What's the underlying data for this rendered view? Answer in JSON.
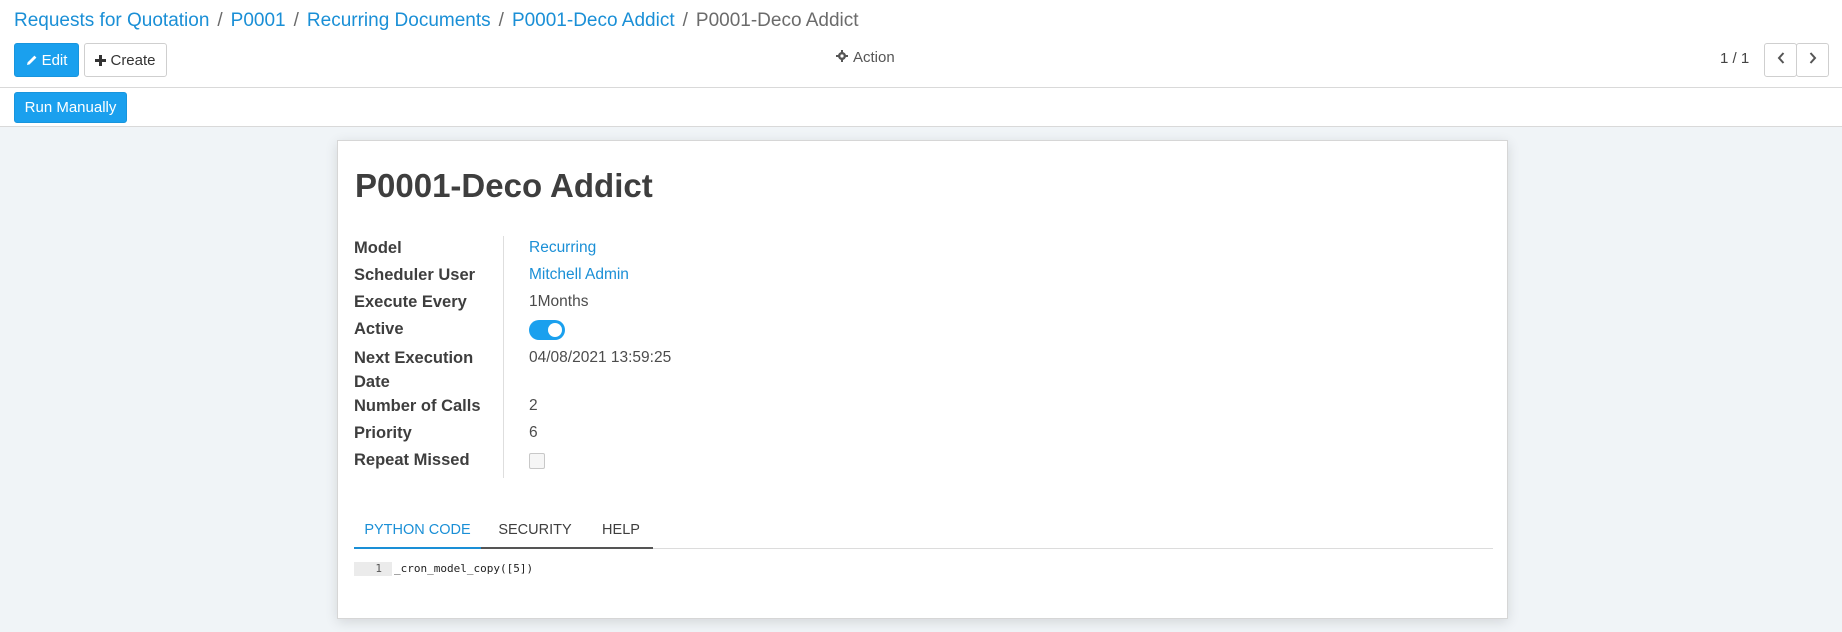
{
  "breadcrumb": {
    "items": [
      "Requests for Quotation",
      "P0001",
      "Recurring Documents",
      "P0001-Deco Addict"
    ],
    "current": "P0001-Deco Addict",
    "separator": "/"
  },
  "toolbar": {
    "edit_label": "Edit",
    "create_label": "Create",
    "action_label": "Action"
  },
  "pager": {
    "value": "1 / 1"
  },
  "statusbar": {
    "run_label": "Run Manually"
  },
  "record": {
    "title": "P0001-Deco Addict",
    "fields": {
      "model": {
        "label": "Model",
        "value": "Recurring"
      },
      "scheduler_user": {
        "label": "Scheduler User",
        "value": "Mitchell Admin"
      },
      "execute_every": {
        "label": "Execute Every",
        "value": "1Months"
      },
      "active": {
        "label": "Active",
        "value": true
      },
      "next_execution": {
        "label_line1": "Next Execution",
        "label_line2": "Date",
        "value": "04/08/2021 13:59:25"
      },
      "number_of_calls": {
        "label": "Number of Calls",
        "value": "2"
      },
      "priority": {
        "label": "Priority",
        "value": "6"
      },
      "repeat_missed": {
        "label": "Repeat Missed",
        "value": false
      }
    }
  },
  "tabs": {
    "python_code": "PYTHON CODE",
    "security": "SECURITY",
    "help": "HELP",
    "active": "PYTHON CODE"
  },
  "code": {
    "line_number": "1",
    "line": "_cron_model_copy([5])"
  },
  "colors": {
    "accent": "#1aa0ee",
    "link": "#1a8fd6",
    "background": "#f0f4f7"
  }
}
